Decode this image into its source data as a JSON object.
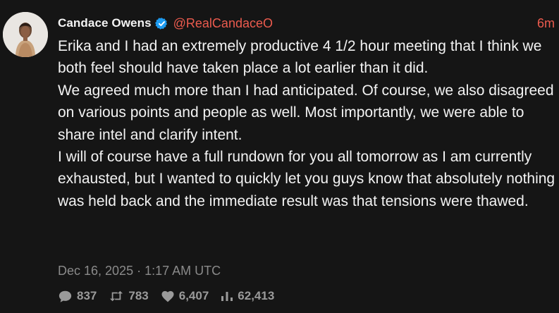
{
  "author": {
    "name": "Candace Owens",
    "handle": "@RealCandaceO",
    "verified_icon": "verified-badge-icon",
    "avatar_icon": "avatar-photo"
  },
  "post": {
    "relative_time": "6m",
    "paragraphs": [
      "Erika and I had an extremely productive 4 1/2 hour meeting that I think we both feel should have taken place a lot earlier than it did.",
      "We agreed much more than I had anticipated. Of course, we also disagreed on various points and people as well. Most importantly, we were able to share intel and clarify intent.",
      "I will of course have a full rundown for you all tomorrow as I am currently exhausted, but I wanted to quickly let you guys know that absolutely nothing was held back and the immediate result was that tensions were thawed."
    ],
    "timestamp": "Dec 16, 2025 · 1:17 AM UTC"
  },
  "stats": {
    "replies": "837",
    "reposts": "783",
    "likes": "6,407",
    "views": "62,413",
    "icons": [
      "comment-icon",
      "repost-icon",
      "heart-icon",
      "views-icon"
    ]
  },
  "colors": {
    "background": "#151515",
    "text": "#f3f3f3",
    "accent": "#ec5b4e",
    "muted": "#8a8a8a",
    "verified": "#1d9bf0"
  }
}
